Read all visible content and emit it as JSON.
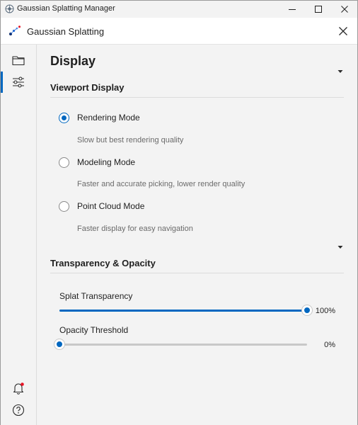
{
  "window": {
    "title": "Gaussian Splatting Manager"
  },
  "header": {
    "title": "Gaussian Splatting"
  },
  "colors": {
    "accent": "#0067c0",
    "notification_dot": "#e81123",
    "description_text": "#6b6b6b"
  },
  "icons": {
    "app": "app-logo-icon",
    "minimize": "minimize-icon",
    "maximize": "maximize-icon",
    "close": "close-icon",
    "folder": "folder-icon",
    "settings": "sliders-icon",
    "notifications": "bell-icon",
    "help": "help-icon",
    "collapse": "caret-down-icon"
  },
  "rail": {
    "active_item": "settings"
  },
  "main": {
    "title": "Display",
    "viewport": {
      "title": "Viewport Display",
      "options": [
        {
          "label": "Rendering Mode",
          "description": "Slow but best rendering quality",
          "checked": true
        },
        {
          "label": "Modeling Mode",
          "description": "Faster and accurate picking, lower render quality",
          "checked": false
        },
        {
          "label": "Point Cloud Mode",
          "description": "Faster display for easy navigation",
          "checked": false
        }
      ]
    },
    "transparency": {
      "title": "Transparency & Opacity",
      "sliders": [
        {
          "label": "Splat Transparency",
          "value": 100,
          "value_text": "100%"
        },
        {
          "label": "Opacity Threshold",
          "value": 0,
          "value_text": "0%"
        }
      ]
    }
  }
}
